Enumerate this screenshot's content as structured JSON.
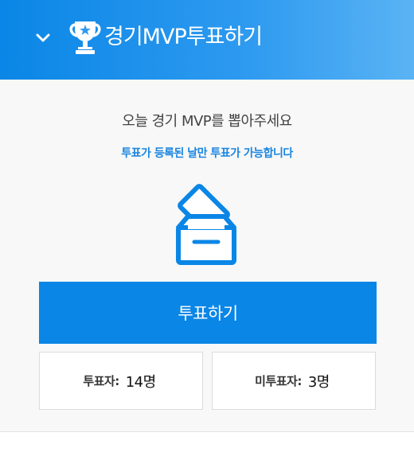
{
  "header": {
    "title": "경기MVP투표하기",
    "collapse_icon": "chevron-down-icon",
    "title_icon": "trophy-icon"
  },
  "main": {
    "prompt": "오늘 경기 MVP를 뽑아주세요",
    "notice": "투표가 등록된 날만 투표가 가능합니다",
    "illustration_icon": "ballot-box-icon",
    "vote_button_label": "투표하기"
  },
  "stats": {
    "voters_label": "투표자:",
    "voters_value": "14명",
    "nonvoters_label": "미투표자:",
    "nonvoters_value": "3명"
  },
  "colors": {
    "accent": "#0a86e6",
    "notice_text": "#1a85e0",
    "header_gradient_end": "#5ab3f4"
  }
}
